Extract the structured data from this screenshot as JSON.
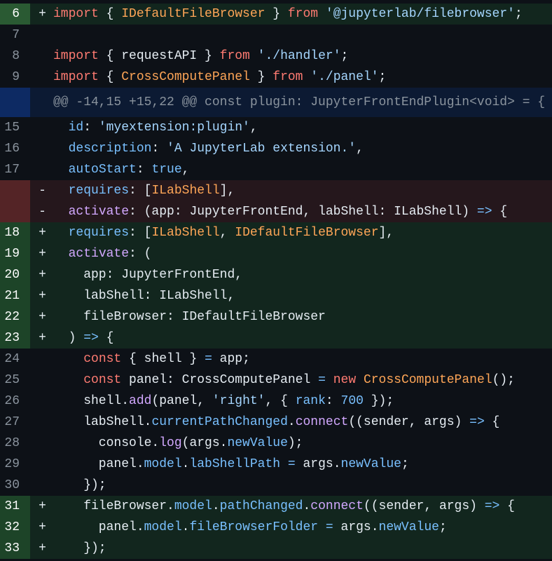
{
  "diff": {
    "rows": [
      {
        "kind": "add",
        "highlight": true,
        "num": "6",
        "marker": "+",
        "tokens": [
          {
            "c": "kw",
            "t": "import"
          },
          {
            "c": "plain",
            "t": " { "
          },
          {
            "c": "cls",
            "t": "IDefaultFileBrowser"
          },
          {
            "c": "plain",
            "t": " } "
          },
          {
            "c": "kw",
            "t": "from"
          },
          {
            "c": "plain",
            "t": " "
          },
          {
            "c": "str",
            "t": "'@jupyterlab/filebrowser'"
          },
          {
            "c": "plain",
            "t": ";"
          }
        ]
      },
      {
        "kind": "context",
        "num": "7",
        "marker": "",
        "tokens": []
      },
      {
        "kind": "context",
        "num": "8",
        "marker": "",
        "tokens": [
          {
            "c": "kw",
            "t": "import"
          },
          {
            "c": "plain",
            "t": " { requestAPI } "
          },
          {
            "c": "kw",
            "t": "from"
          },
          {
            "c": "plain",
            "t": " "
          },
          {
            "c": "str",
            "t": "'./handler'"
          },
          {
            "c": "plain",
            "t": ";"
          }
        ]
      },
      {
        "kind": "context",
        "num": "9",
        "marker": "",
        "tokens": [
          {
            "c": "kw",
            "t": "import"
          },
          {
            "c": "plain",
            "t": " { "
          },
          {
            "c": "cls",
            "t": "CrossComputePanel"
          },
          {
            "c": "plain",
            "t": " } "
          },
          {
            "c": "kw",
            "t": "from"
          },
          {
            "c": "plain",
            "t": " "
          },
          {
            "c": "str",
            "t": "'./panel'"
          },
          {
            "c": "plain",
            "t": ";"
          }
        ]
      },
      {
        "kind": "hunk",
        "num": "",
        "marker": "",
        "tokens": [
          {
            "c": "dim",
            "t": "@@ -14,15 +15,22 @@ const plugin: JupyterFrontEndPlugin<void> = {"
          }
        ]
      },
      {
        "kind": "context",
        "num": "15",
        "marker": "",
        "tokens": [
          {
            "c": "plain",
            "t": "  "
          },
          {
            "c": "prop",
            "t": "id"
          },
          {
            "c": "plain",
            "t": ": "
          },
          {
            "c": "str",
            "t": "'myextension:plugin'"
          },
          {
            "c": "plain",
            "t": ","
          }
        ]
      },
      {
        "kind": "context",
        "num": "16",
        "marker": "",
        "tokens": [
          {
            "c": "plain",
            "t": "  "
          },
          {
            "c": "prop",
            "t": "description"
          },
          {
            "c": "plain",
            "t": ": "
          },
          {
            "c": "str",
            "t": "'A JupyterLab extension.'"
          },
          {
            "c": "plain",
            "t": ","
          }
        ]
      },
      {
        "kind": "context",
        "num": "17",
        "marker": "",
        "tokens": [
          {
            "c": "plain",
            "t": "  "
          },
          {
            "c": "prop",
            "t": "autoStart"
          },
          {
            "c": "plain",
            "t": ": "
          },
          {
            "c": "num",
            "t": "true"
          },
          {
            "c": "plain",
            "t": ","
          }
        ]
      },
      {
        "kind": "del",
        "num": "",
        "marker": "-",
        "tokens": [
          {
            "c": "plain",
            "t": "  "
          },
          {
            "c": "prop",
            "t": "requires"
          },
          {
            "c": "plain",
            "t": ": ["
          },
          {
            "c": "cls",
            "t": "ILabShell"
          },
          {
            "c": "plain",
            "t": "],"
          }
        ]
      },
      {
        "kind": "del",
        "num": "",
        "marker": "-",
        "tokens": [
          {
            "c": "plain",
            "t": "  "
          },
          {
            "c": "key",
            "t": "activate"
          },
          {
            "c": "plain",
            "t": ": (app: JupyterFrontEnd, labShell: ILabShell) "
          },
          {
            "c": "op",
            "t": "=>"
          },
          {
            "c": "plain",
            "t": " {"
          }
        ]
      },
      {
        "kind": "add",
        "num": "18",
        "marker": "+",
        "tokens": [
          {
            "c": "plain",
            "t": "  "
          },
          {
            "c": "prop",
            "t": "requires"
          },
          {
            "c": "plain",
            "t": ": ["
          },
          {
            "c": "cls",
            "t": "ILabShell"
          },
          {
            "c": "plain",
            "t": ", "
          },
          {
            "c": "cls",
            "t": "IDefaultFileBrowser"
          },
          {
            "c": "plain",
            "t": "],"
          }
        ]
      },
      {
        "kind": "add",
        "num": "19",
        "marker": "+",
        "tokens": [
          {
            "c": "plain",
            "t": "  "
          },
          {
            "c": "key",
            "t": "activate"
          },
          {
            "c": "plain",
            "t": ": ("
          }
        ]
      },
      {
        "kind": "add",
        "num": "20",
        "marker": "+",
        "tokens": [
          {
            "c": "plain",
            "t": "    app: JupyterFrontEnd,"
          }
        ]
      },
      {
        "kind": "add",
        "num": "21",
        "marker": "+",
        "tokens": [
          {
            "c": "plain",
            "t": "    labShell: ILabShell,"
          }
        ]
      },
      {
        "kind": "add",
        "num": "22",
        "marker": "+",
        "tokens": [
          {
            "c": "plain",
            "t": "    fileBrowser: IDefaultFileBrowser"
          }
        ]
      },
      {
        "kind": "add",
        "num": "23",
        "marker": "+",
        "tokens": [
          {
            "c": "plain",
            "t": "  ) "
          },
          {
            "c": "op",
            "t": "=>"
          },
          {
            "c": "plain",
            "t": " {"
          }
        ]
      },
      {
        "kind": "context",
        "num": "24",
        "marker": "",
        "tokens": [
          {
            "c": "plain",
            "t": "    "
          },
          {
            "c": "kw",
            "t": "const"
          },
          {
            "c": "plain",
            "t": " { shell } "
          },
          {
            "c": "op",
            "t": "="
          },
          {
            "c": "plain",
            "t": " app;"
          }
        ]
      },
      {
        "kind": "context",
        "num": "25",
        "marker": "",
        "tokens": [
          {
            "c": "plain",
            "t": "    "
          },
          {
            "c": "kw",
            "t": "const"
          },
          {
            "c": "plain",
            "t": " panel: CrossComputePanel "
          },
          {
            "c": "op",
            "t": "="
          },
          {
            "c": "plain",
            "t": " "
          },
          {
            "c": "kw",
            "t": "new"
          },
          {
            "c": "plain",
            "t": " "
          },
          {
            "c": "cls",
            "t": "CrossComputePanel"
          },
          {
            "c": "plain",
            "t": "();"
          }
        ]
      },
      {
        "kind": "context",
        "num": "26",
        "marker": "",
        "tokens": [
          {
            "c": "plain",
            "t": "    shell."
          },
          {
            "c": "fn",
            "t": "add"
          },
          {
            "c": "plain",
            "t": "(panel, "
          },
          {
            "c": "str",
            "t": "'right'"
          },
          {
            "c": "plain",
            "t": ", { "
          },
          {
            "c": "prop",
            "t": "rank"
          },
          {
            "c": "plain",
            "t": ": "
          },
          {
            "c": "num",
            "t": "700"
          },
          {
            "c": "plain",
            "t": " });"
          }
        ]
      },
      {
        "kind": "context",
        "num": "27",
        "marker": "",
        "tokens": [
          {
            "c": "plain",
            "t": "    labShell."
          },
          {
            "c": "prop",
            "t": "currentPathChanged"
          },
          {
            "c": "plain",
            "t": "."
          },
          {
            "c": "fn",
            "t": "connect"
          },
          {
            "c": "plain",
            "t": "((sender, args) "
          },
          {
            "c": "op",
            "t": "=>"
          },
          {
            "c": "plain",
            "t": " {"
          }
        ]
      },
      {
        "kind": "context",
        "num": "28",
        "marker": "",
        "tokens": [
          {
            "c": "plain",
            "t": "      console."
          },
          {
            "c": "fn",
            "t": "log"
          },
          {
            "c": "plain",
            "t": "(args."
          },
          {
            "c": "prop",
            "t": "newValue"
          },
          {
            "c": "plain",
            "t": ");"
          }
        ]
      },
      {
        "kind": "context",
        "num": "29",
        "marker": "",
        "tokens": [
          {
            "c": "plain",
            "t": "      panel."
          },
          {
            "c": "prop",
            "t": "model"
          },
          {
            "c": "plain",
            "t": "."
          },
          {
            "c": "prop",
            "t": "labShellPath"
          },
          {
            "c": "plain",
            "t": " "
          },
          {
            "c": "op",
            "t": "="
          },
          {
            "c": "plain",
            "t": " args."
          },
          {
            "c": "prop",
            "t": "newValue"
          },
          {
            "c": "plain",
            "t": ";"
          }
        ]
      },
      {
        "kind": "context",
        "num": "30",
        "marker": "",
        "tokens": [
          {
            "c": "plain",
            "t": "    });"
          }
        ]
      },
      {
        "kind": "add",
        "num": "31",
        "marker": "+",
        "tokens": [
          {
            "c": "plain",
            "t": "    fileBrowser."
          },
          {
            "c": "prop",
            "t": "model"
          },
          {
            "c": "plain",
            "t": "."
          },
          {
            "c": "prop",
            "t": "pathChanged"
          },
          {
            "c": "plain",
            "t": "."
          },
          {
            "c": "fn",
            "t": "connect"
          },
          {
            "c": "plain",
            "t": "((sender, args) "
          },
          {
            "c": "op",
            "t": "=>"
          },
          {
            "c": "plain",
            "t": " {"
          }
        ]
      },
      {
        "kind": "add",
        "num": "32",
        "marker": "+",
        "tokens": [
          {
            "c": "plain",
            "t": "      panel."
          },
          {
            "c": "prop",
            "t": "model"
          },
          {
            "c": "plain",
            "t": "."
          },
          {
            "c": "prop",
            "t": "fileBrowserFolder"
          },
          {
            "c": "plain",
            "t": " "
          },
          {
            "c": "op",
            "t": "="
          },
          {
            "c": "plain",
            "t": " args."
          },
          {
            "c": "prop",
            "t": "newValue"
          },
          {
            "c": "plain",
            "t": ";"
          }
        ]
      },
      {
        "kind": "add",
        "num": "33",
        "marker": "+",
        "tokens": [
          {
            "c": "plain",
            "t": "    });"
          }
        ]
      }
    ]
  }
}
